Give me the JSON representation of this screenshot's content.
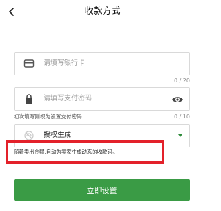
{
  "header": {
    "title": "收款方式"
  },
  "form": {
    "bank_card": {
      "placeholder": "请填写银行卡",
      "counter": "0 / 20"
    },
    "pay_password": {
      "placeholder": "请填写支付密码",
      "counter": "0 / 10"
    },
    "password_hint": "初次填写则视为设置支付密码",
    "authorization": {
      "selected": "授权生成"
    },
    "note": "随着卖出金额,自动为卖家生成动态的收款码。",
    "submit_label": "立即设置"
  },
  "colors": {
    "accent_green": "#3a9b45",
    "highlight_red": "#e3212a"
  }
}
